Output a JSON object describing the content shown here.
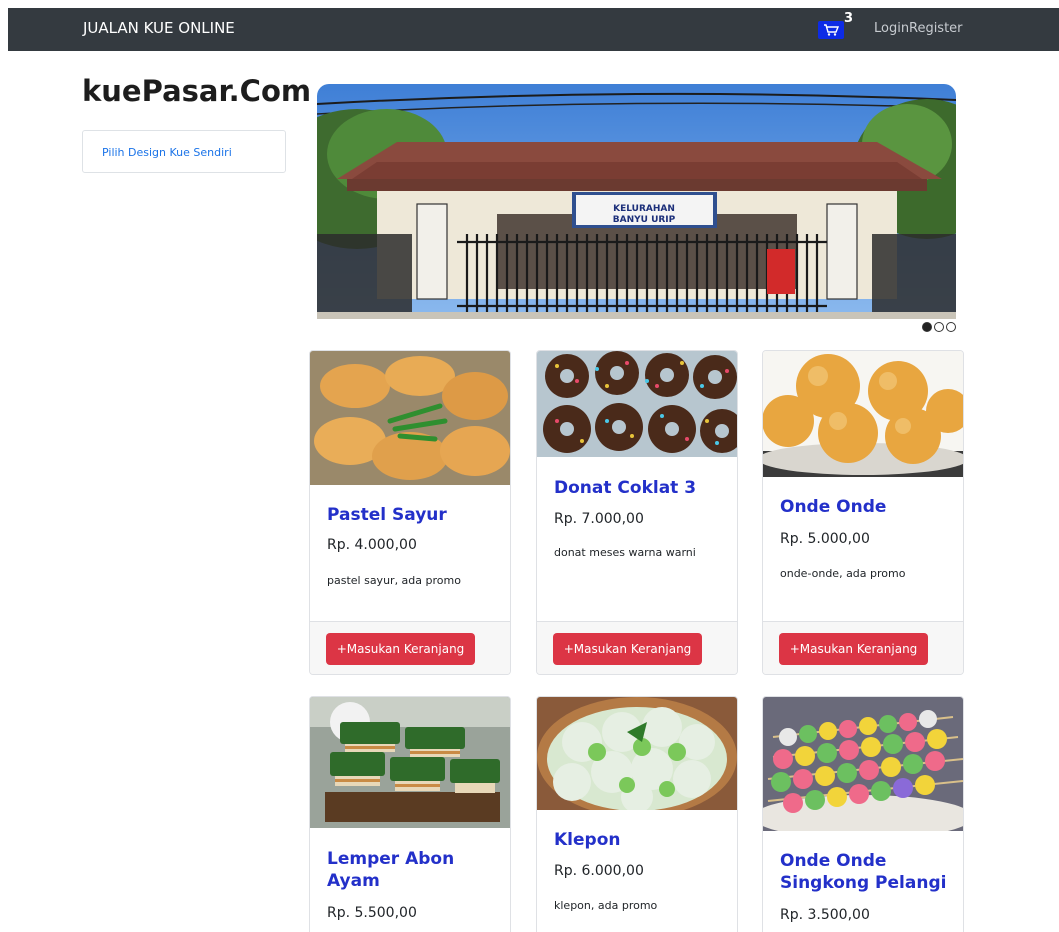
{
  "navbar": {
    "brand": "JUALAN KUE ONLINE",
    "cart_count": "3",
    "cart_icon": "cart-icon",
    "login_label": "Login",
    "register_label": "Register"
  },
  "sidebar": {
    "site_title": "kuePasar.Com",
    "design_link": "Pilih Design Kue Sendiri"
  },
  "carousel": {
    "sign_lines": [
      "KELURAHAN",
      "BANYU URIP"
    ],
    "slide_count": 3,
    "active_slide": 1
  },
  "products": [
    {
      "name": "Pastel Sayur",
      "price": "Rp. 4.000,00",
      "desc": "pastel sayur, ada promo",
      "button": "+Masukan Keranjang"
    },
    {
      "name": "Donat Coklat 3",
      "price": "Rp. 7.000,00",
      "desc": "donat meses warna warni",
      "button": "+Masukan Keranjang"
    },
    {
      "name": "Onde Onde",
      "price": "Rp. 5.000,00",
      "desc": "onde-onde, ada promo",
      "button": "+Masukan Keranjang"
    },
    {
      "name": "Lemper Abon Ayam",
      "price": "Rp. 5.500,00",
      "desc": "",
      "button": ""
    },
    {
      "name": "Klepon",
      "price": "Rp. 6.000,00",
      "desc": "klepon, ada promo",
      "button": ""
    },
    {
      "name": "Onde Onde Singkong Pelangi",
      "price": "Rp. 3.500,00",
      "desc": "",
      "button": ""
    }
  ],
  "colors": {
    "navbar_bg": "#343a40",
    "title_blue": "#2330c9",
    "button_red": "#dc3545",
    "cart_blue": "#0d2be6"
  }
}
